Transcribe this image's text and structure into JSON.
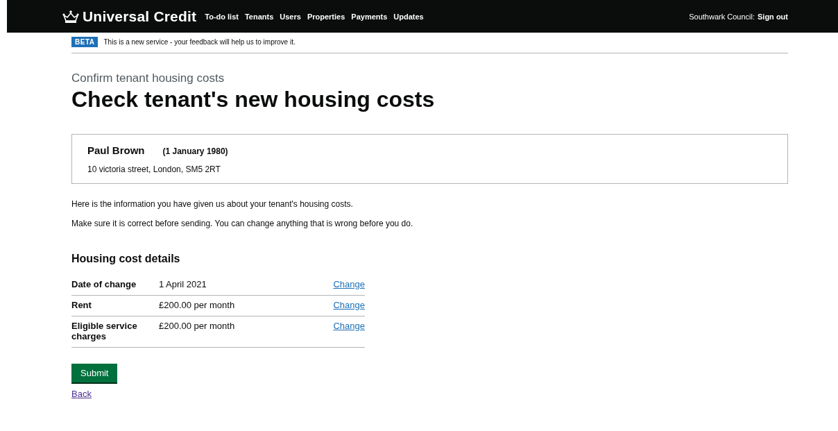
{
  "header": {
    "service_name": "Universal Credit",
    "nav": [
      {
        "label": "To-do list"
      },
      {
        "label": "Tenants"
      },
      {
        "label": "Users"
      },
      {
        "label": "Properties"
      },
      {
        "label": "Payments"
      },
      {
        "label": "Updates"
      }
    ],
    "account": "Southwark Council:",
    "sign_out": "Sign out"
  },
  "phase_banner": {
    "tag": "BETA",
    "text": "This is a new service - your feedback will help us to improve it."
  },
  "caption": "Confirm tenant housing costs",
  "heading": "Check tenant's new housing costs",
  "tenant_card": {
    "name": "Paul Brown",
    "date_of_birth": "(1 January 1980)",
    "address": "10 victoria street, London, SM5 2RT"
  },
  "paragraphs": [
    "Here is the information you have given us about your tenant's housing costs.",
    "Make sure it is correct before sending. You can change anything that is wrong before you do."
  ],
  "summary": {
    "title": "Housing cost details",
    "rows": [
      {
        "key": "Date of change",
        "value": "1 April 2021",
        "action": "Change"
      },
      {
        "key": "Rent",
        "value": "£200.00 per month",
        "action": "Change"
      },
      {
        "key": "Eligible service charges",
        "value": "£200.00 per month",
        "action": "Change"
      }
    ]
  },
  "submit_button": "Submit",
  "back_link": {
    "label": "Back",
    "visited": true
  }
}
